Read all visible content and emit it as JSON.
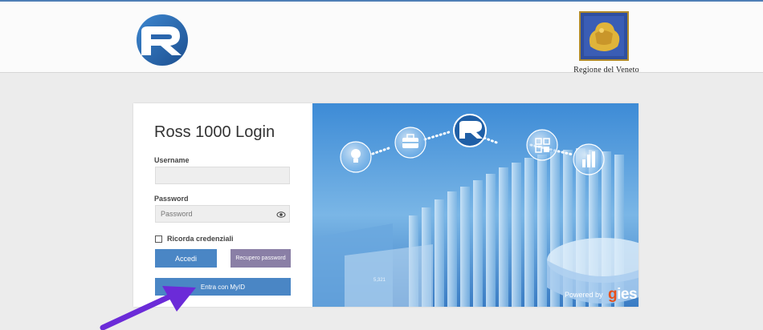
{
  "header": {
    "region_name": "Regione del Veneto",
    "brand_icon": "ross-r-logo-icon",
    "region_icon": "veneto-lion-crest-icon"
  },
  "login": {
    "title": "Ross 1000 Login",
    "username_label": "Username",
    "username_value": "",
    "password_label": "Password",
    "password_placeholder": "Password",
    "remember_label": "Ricorda credenziali",
    "accedi_label": "Accedi",
    "recupero_label": "Recupero password",
    "myid_label": "Entra con MyID"
  },
  "hero": {
    "chart_value": "5,321",
    "powered_by": "Powered by",
    "powered_brand": "gies",
    "icons": [
      "lightbulb-icon",
      "briefcase-icon",
      "ross-r-logo-icon",
      "grid-icon",
      "bar-chart-icon"
    ]
  },
  "annotation": {
    "arrow_color": "#6b2bd8"
  },
  "colors": {
    "primary_button": "#4a86c5",
    "secondary_button": "#8a7fa6",
    "header_line": "#4f7fb6"
  }
}
